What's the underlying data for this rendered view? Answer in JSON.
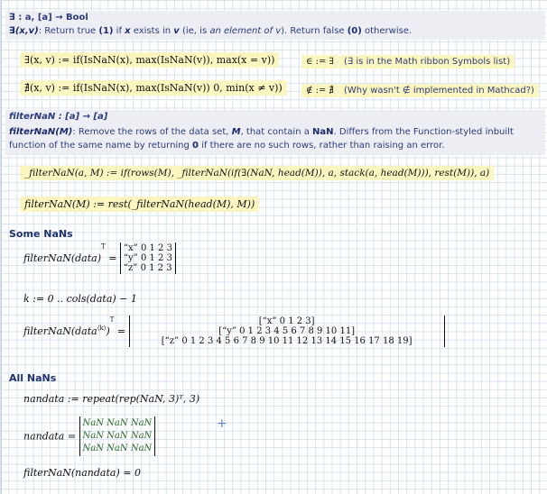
{
  "exists_def": {
    "signature": "∃ : a, [a] → Bool",
    "desc_head": "∃(x,v)",
    "desc_1": ": Return true ",
    "desc_bold_1": "(1)",
    "desc_2": " if ",
    "desc_x": "x",
    "desc_3": " exists in ",
    "desc_v": "v",
    "desc_4": " (ie, is ",
    "desc_elem": "an element of v",
    "desc_5": "). Return false ",
    "desc_bold_0": "(0)",
    "desc_6": " otherwise."
  },
  "exists_expr": "∃(x, v) := if(IsNaN(x), max(IsNaN(v)), max(x = v))",
  "exists_alias": "∈ := ∃",
  "exists_note": "(∃ is in the Math ribbon Symbols list)",
  "notexists_expr": "∄(x, v) := if(IsNaN(x), max(IsNaN(v)) 0, min(x ≠ v))",
  "notexists_alias": "∉ := ∄",
  "notexists_note": "(Why wasn't ∉ implemented in Mathcad?)",
  "filter_def": {
    "signature": "filterNaN : [a] → [a]",
    "desc_head": "filterNaN(M)",
    "desc_1": ": Remove the rows of the data set, ",
    "desc_m": "M",
    "desc_2": ", that contain a ",
    "desc_nan": "NaN",
    "desc_3": ".  Differs from the Function-styled inbuilt",
    "desc_line2a": "function of the same name by returning ",
    "desc_zero": "0",
    "desc_line2b": " if there are no such rows, rather than raising an error."
  },
  "filter_helper_expr": "_filterNaN(a, M) := if(rows(M), _filterNaN(if(∃(NaN, head(M)), a, stack(a, head(M))), rest(M)), a)",
  "filter_main_expr": "filterNaN(M) := rest(_filterNaN(head(M), M))",
  "some_nans": {
    "title": "Some NaNs",
    "eval_lhs": "filterNaN(data)",
    "sup_t": "T",
    "eq": "=",
    "matrix_rows": [
      "“x”  0  1  2  3",
      "“y”  0  1  2  3",
      "“z”  0  1  2  3"
    ],
    "range_expr": "k := 0 .. cols(data) − 1",
    "eval2_lhs": "filterNaN(data",
    "eval2_sup": "⟨k⟩",
    "eval2_close": ")",
    "nested_rows": [
      "[“x”  0  1  2  3]",
      "[“y”  0  1  2  3  4  5  6  7  8  9  10  11]",
      "[“z”  0  1  2  3  4  5  6  7  8  9  10  11  12  13  14  15  16  17  18  19]"
    ]
  },
  "all_nans": {
    "title": "All NaNs",
    "def_expr": "nandata := repeat(rep(NaN, 3)ᵀ, 3)",
    "eval_lhs": "nandata",
    "eq": "=",
    "matrix_rows": [
      "NaN  NaN  NaN",
      "NaN  NaN  NaN",
      "NaN  NaN  NaN"
    ],
    "result_expr": "filterNaN(nandata) = 0"
  }
}
